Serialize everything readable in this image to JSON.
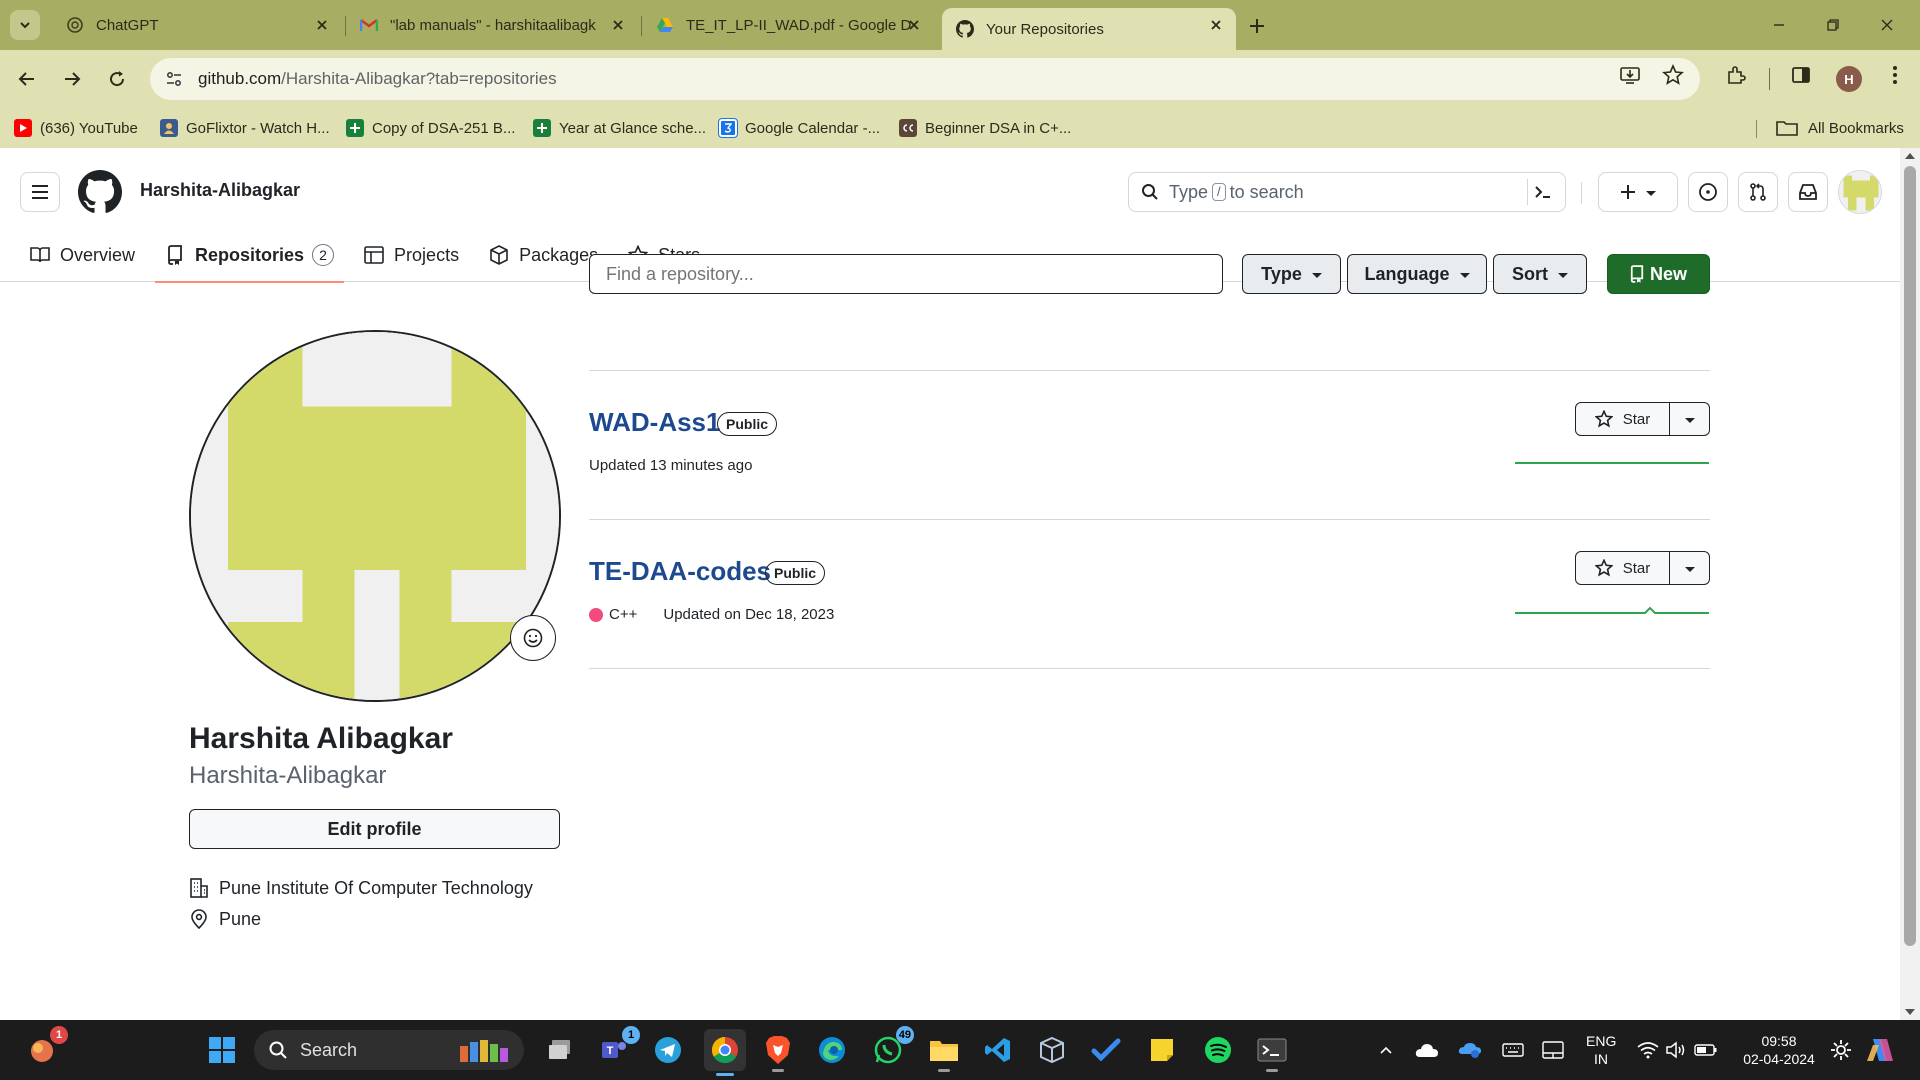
{
  "browser": {
    "tabs": [
      {
        "title": "ChatGPT",
        "icon": "chatgpt-icon"
      },
      {
        "title": "\"lab manuals\" - harshitaalibagk",
        "icon": "gmail-icon"
      },
      {
        "title": "TE_IT_LP-II_WAD.pdf - Google D",
        "icon": "google-drive-icon"
      },
      {
        "title": "Your Repositories",
        "icon": "github-icon"
      }
    ],
    "url_host": "github.com",
    "url_path": "/Harshita-Alibagkar?tab=repositories",
    "profile_initial": "H",
    "bookmarks": [
      {
        "label": "(636) YouTube",
        "icon": "youtube-icon"
      },
      {
        "label": "GoFlixtor - Watch H...",
        "icon": "goflixtor-icon"
      },
      {
        "label": "Copy of DSA-251 B...",
        "icon": "sheets-icon"
      },
      {
        "label": "Year at Glance sche...",
        "icon": "sheets-icon"
      },
      {
        "label": "Google Calendar -...",
        "icon": "calendar-icon"
      },
      {
        "label": "Beginner DSA in C+...",
        "icon": "codechef-icon"
      }
    ],
    "all_bookmarks": "All Bookmarks"
  },
  "github": {
    "username": "Harshita-Alibagkar",
    "search_prefix": "Type",
    "search_key": "/",
    "search_suffix": "to search",
    "nav": {
      "overview": "Overview",
      "repositories": "Repositories",
      "repositories_count": "2",
      "projects": "Projects",
      "packages": "Packages",
      "stars": "Stars"
    },
    "profile": {
      "full_name": "Harshita Alibagkar",
      "login": "Harshita-Alibagkar",
      "edit_label": "Edit profile",
      "organization": "Pune Institute Of Computer Technology",
      "location": "Pune"
    },
    "filters": {
      "find_placeholder": "Find a repository...",
      "type": "Type",
      "language": "Language",
      "sort": "Sort",
      "new": "New"
    },
    "repos": [
      {
        "name": "WAD-Ass1",
        "visibility": "Public",
        "language": "",
        "updated": "Updated 13 minutes ago",
        "star_label": "Star"
      },
      {
        "name": "TE-DAA-codes",
        "visibility": "Public",
        "language": "C++",
        "updated": "Updated on Dec 18, 2023",
        "star_label": "Star"
      }
    ],
    "colors": {
      "accent_green": "#1f6b2a",
      "link_blue": "#1d4a8f",
      "cpp_dot": "#f34b7d",
      "identicon": "#d4da6a"
    }
  },
  "taskbar": {
    "search_label": "Search",
    "teams_badge": "1",
    "whatsapp_badge": "49",
    "widget_badge": "1",
    "lang_line1": "ENG",
    "lang_line2": "IN",
    "time": "09:58",
    "date": "02-04-2024"
  }
}
